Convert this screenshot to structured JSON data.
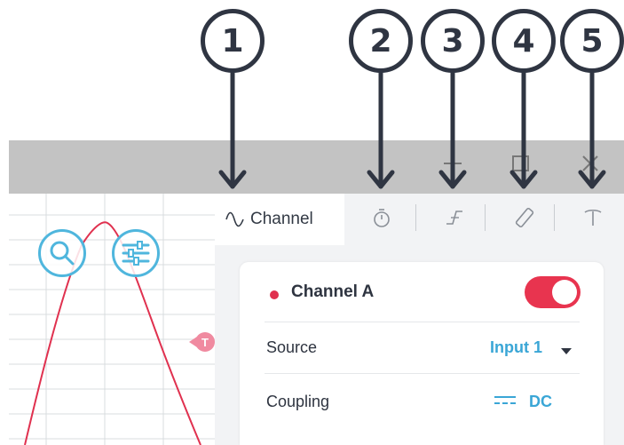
{
  "callouts": [
    "1",
    "2",
    "3",
    "4",
    "5"
  ],
  "icons": {
    "minimize": "minimize-icon",
    "maximize": "maximize-icon",
    "close": "close-icon",
    "zoom": "magnifier-icon",
    "adjust": "sliders-icon",
    "timebase": "stopwatch-icon",
    "trigger": "trigger-edge-icon",
    "measurement": "ruler-icon",
    "probe": "probe-icon",
    "coupling": "dc-coupling-icon"
  },
  "tabs": {
    "active_label": "Channel"
  },
  "trigger_marker": "T",
  "channel": {
    "name": "Channel A",
    "enabled": true,
    "rows": [
      {
        "label": "Source",
        "value": "Input 1"
      },
      {
        "label": "Coupling",
        "value": "DC"
      }
    ]
  },
  "colors": {
    "accent_blue": "#3aa6d6",
    "channel_red": "#e0314f",
    "toggle_on": "#e8344f",
    "callout_dark": "#2f3542",
    "titlebar": "#c3c3c3"
  }
}
